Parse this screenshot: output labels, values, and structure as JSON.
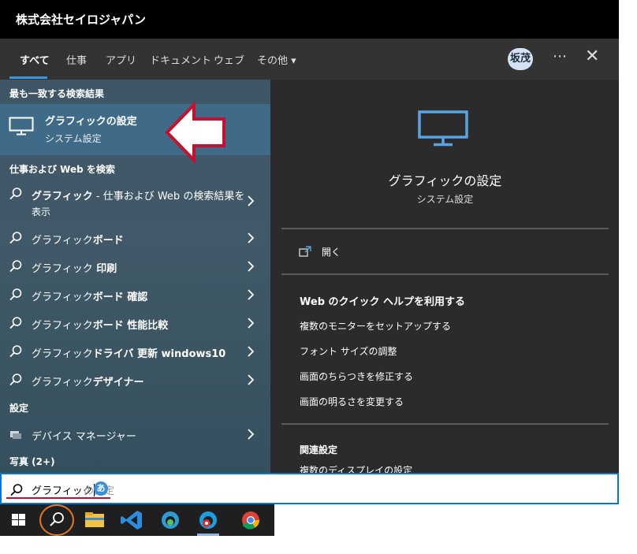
{
  "window": {
    "title": "株式会社セイロジャパン"
  },
  "nav": {
    "tabs": [
      {
        "label": "すべて"
      },
      {
        "label": "仕事"
      },
      {
        "label": "アプリ"
      },
      {
        "label": "ドキュメント"
      },
      {
        "label": "ウェブ"
      },
      {
        "label": "その他 ▾"
      }
    ],
    "avatar": "坂茂",
    "more": "⋯",
    "close": "✕"
  },
  "left": {
    "best_match_header": "最も一致する検索結果",
    "best_match": {
      "title": "グラフィックの設定",
      "subtitle": "システム設定"
    },
    "web_header": "仕事および Web を検索",
    "web_results": [
      {
        "prefix": "グラフィック",
        "rest": " - 仕事および Web の検索結果を",
        "line2": "表示"
      },
      {
        "prefix": "グラフィック",
        "rest": "ボード"
      },
      {
        "prefix": "グラフィック",
        "rest": " 印刷"
      },
      {
        "prefix": "グラフィック",
        "rest": "ボード 確認"
      },
      {
        "prefix": "グラフィック",
        "rest": "ボード 性能比較"
      },
      {
        "prefix": "グラフィック",
        "rest": "ドライバ 更新 windows10"
      },
      {
        "prefix": "グラフィック",
        "rest": "デザイナー"
      }
    ],
    "settings_header": "設定",
    "settings_item": "デバイス マネージャー",
    "photos_header": "写真 (2+)"
  },
  "right": {
    "title": "グラフィックの設定",
    "subtitle": "システム設定",
    "open": "開く",
    "help_header": "Web のクイック ヘルプを利用する",
    "help_links": [
      "複数のモニターをセットアップする",
      "フォント サイズの調整",
      "画面のちらつきを修正する",
      "画面の明るさを変更する"
    ],
    "related_header": "関連設定",
    "related_cut": "複数のディスプレイの設定"
  },
  "search": {
    "query": "グラフィック",
    "ghost": "の設定"
  },
  "colors": {
    "accent": "#0078d7",
    "annotation_red": "#c8102e",
    "annotation_orange": "#e87722"
  }
}
